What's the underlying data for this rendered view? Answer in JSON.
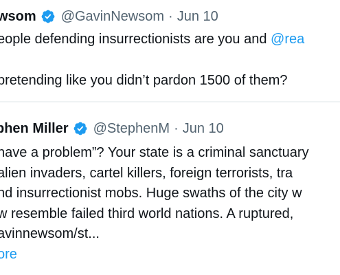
{
  "tweets": [
    {
      "display_name": "wsom",
      "handle": "@GavinNewsom",
      "separator": "·",
      "date": "Jun 10",
      "lines": [
        "eople defending insurrectionists are you and",
        "pretending like you didn’t pardon 1500 of them?"
      ],
      "mention": "@rea"
    },
    {
      "display_name": "phen Miller",
      "handle": "@StephenM",
      "separator": "·",
      "date": "Jun 10",
      "lines": [
        "have a problem”? Your state is a criminal sanctuary",
        "alien invaders, cartel killers, foreign terrorists, tra",
        "nd insurrectionist mobs. Huge swaths of the city w",
        "w resemble failed third world nations. A ruptured,",
        "avinnewsom/st..."
      ],
      "show_more": "ore"
    }
  ],
  "colors": {
    "text": "#0f1419",
    "secondary": "#536471",
    "link": "#1d9bf0",
    "divider": "#eff3f4"
  }
}
